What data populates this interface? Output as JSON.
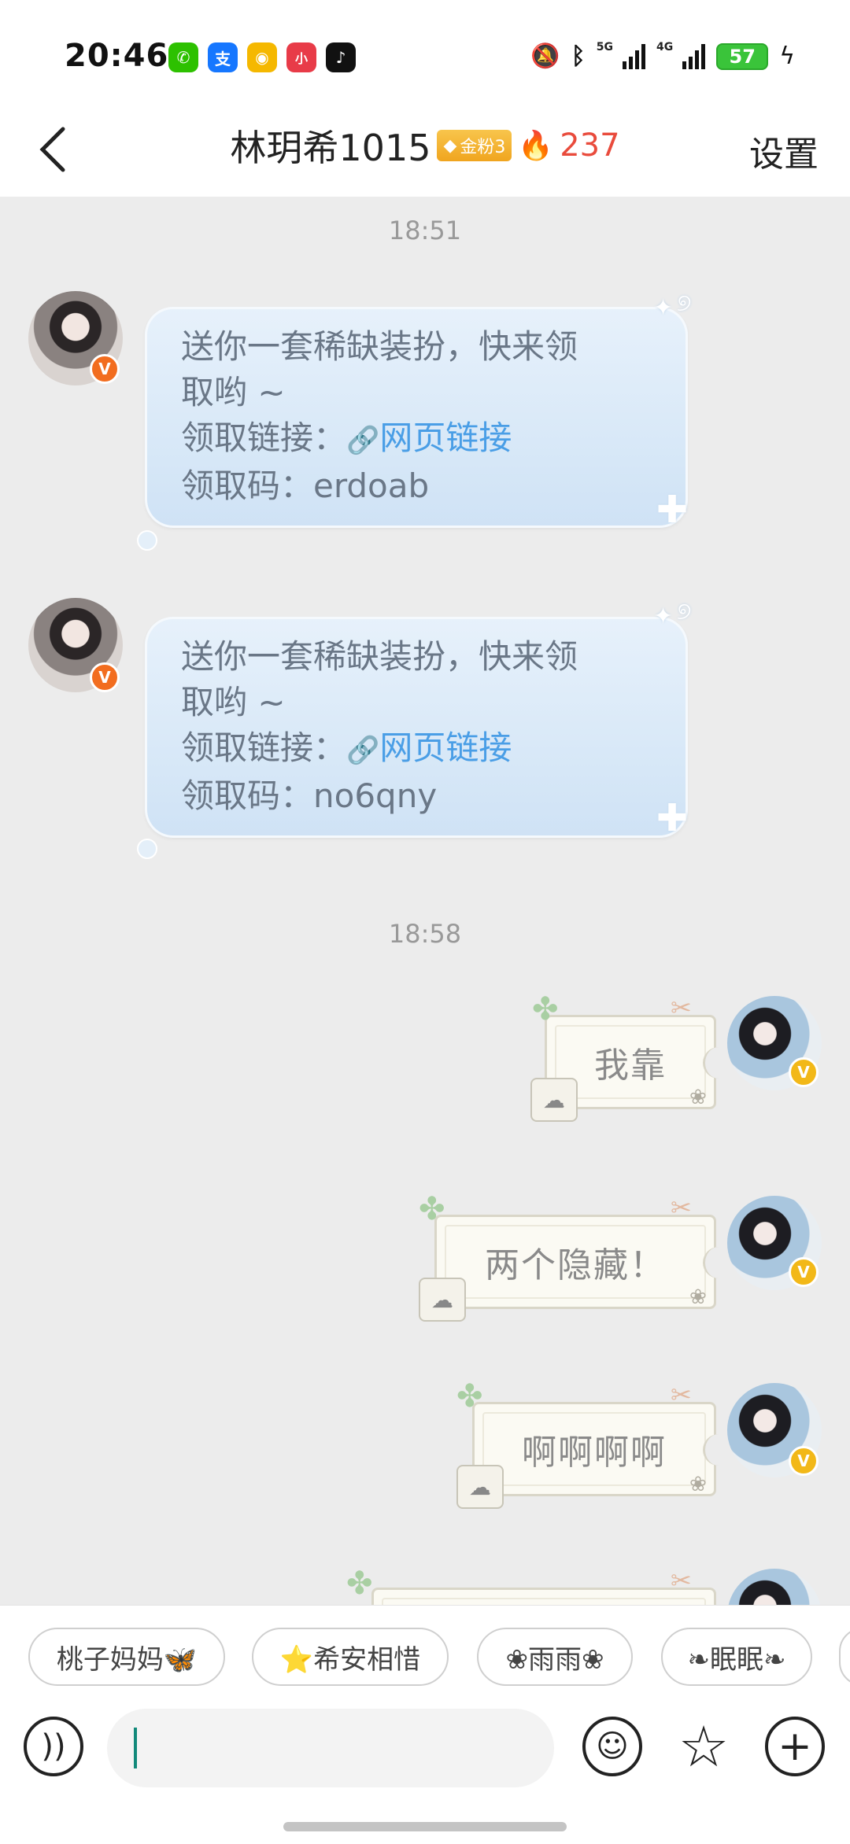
{
  "status_bar": {
    "time": "20:46",
    "apps": [
      {
        "icon": "wechat-icon",
        "glyph": "✆",
        "color": "#2dc100"
      },
      {
        "icon": "alipay-icon",
        "glyph": "支",
        "color": "#1677ff"
      },
      {
        "icon": "weibo-icon",
        "glyph": "◉",
        "color": "#f5b800"
      },
      {
        "icon": "xiaohongshu-icon",
        "glyph": "小",
        "color": "#e83b48"
      },
      {
        "icon": "tiktok-icon",
        "glyph": "♪",
        "color": "#111111"
      }
    ],
    "network_1": "5G",
    "network_2": "4G",
    "battery": "57"
  },
  "header": {
    "title": "林玥希1015",
    "fan_badge": "金粉3",
    "fire_count": "237",
    "settings_label": "设置"
  },
  "chat": {
    "timestamp_1": "18:51",
    "timestamp_2": "18:58",
    "received": [
      {
        "line1": "送你一套稀缺装扮，快来领",
        "line2": "取哟 ~",
        "link_prefix": "领取链接：",
        "link_text": "网页链接",
        "code_line": "领取码：erdoab"
      },
      {
        "line1": "送你一套稀缺装扮，快来领",
        "line2": "取哟 ~",
        "link_prefix": "领取链接：",
        "link_text": "网页链接",
        "code_line": "领取码：no6qny"
      }
    ],
    "sent": [
      {
        "text": "我靠"
      },
      {
        "text": "两个隐藏！"
      },
      {
        "text": "啊啊啊啊"
      }
    ]
  },
  "quick_replies": [
    "桃子妈妈🦋",
    "⭐希安相惜",
    "❀雨雨❀",
    "❧眠眠❧"
  ],
  "input": {
    "voice_icon": "voice-icon",
    "emoji_icon": "emoji-icon",
    "sticker_icon": "sticker-icon",
    "plus_icon": "plus-icon"
  }
}
